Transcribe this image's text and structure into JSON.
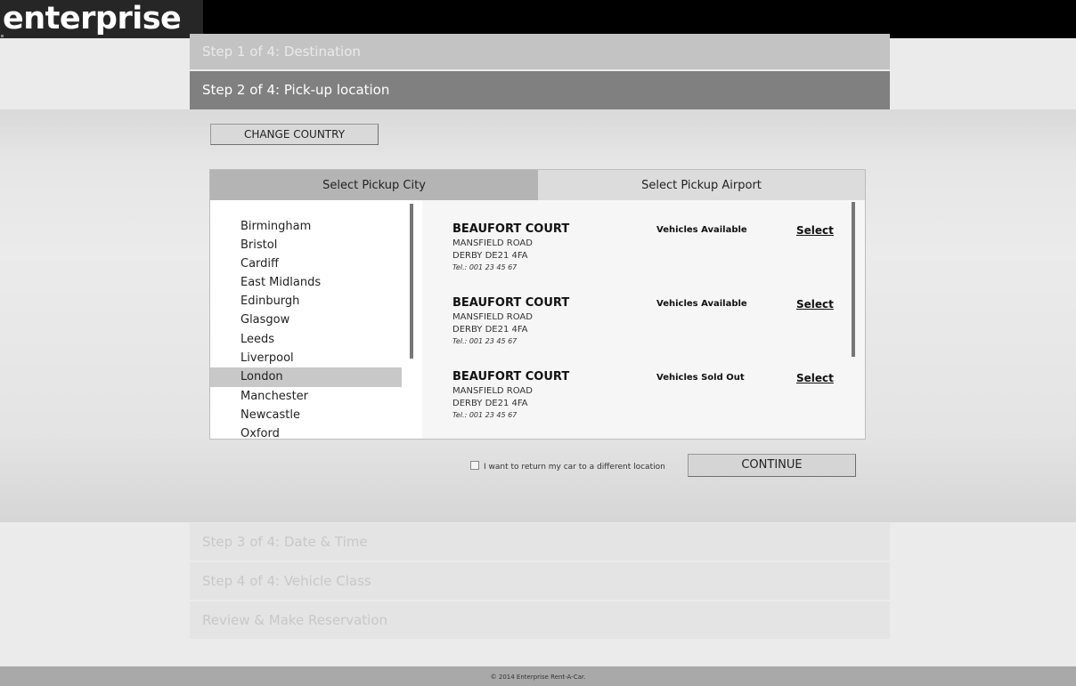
{
  "header": {
    "logo_text": "enterprise"
  },
  "steps": [
    "Step 1 of 4: Destination",
    "Step 2 of 4: Pick-up location",
    "Step 3 of 4: Date & Time",
    "Step 4 of 4: Vehicle Class",
    "Review & Make Reservation"
  ],
  "change_country_label": "CHANGE COUNTRY",
  "tabs": {
    "city": "Select Pickup City",
    "airport": "Select Pickup Airport"
  },
  "cities": [
    "Birmingham",
    "Bristol",
    "Cardiff",
    "East Midlands",
    "Edinburgh",
    "Glasgow",
    "Leeds",
    "Liverpool",
    "London",
    "Manchester",
    "Newcastle",
    "Oxford"
  ],
  "selected_city": "London",
  "locations": [
    {
      "name": "BEAUFORT COURT",
      "line1": "MANSFIELD ROAD",
      "line2": "DERBY DE21 4FA",
      "tel": "Tel.: 001 23 45 67",
      "status": "Vehicles Available",
      "select": "Select"
    },
    {
      "name": "BEAUFORT COURT",
      "line1": "MANSFIELD ROAD",
      "line2": "DERBY DE21 4FA",
      "tel": "Tel.: 001 23 45 67",
      "status": "Vehicles Available",
      "select": "Select"
    },
    {
      "name": "BEAUFORT COURT",
      "line1": "MANSFIELD ROAD",
      "line2": "DERBY DE21 4FA",
      "tel": "Tel.: 001 23 45 67",
      "status": "Vehicles Sold Out",
      "select": "Select"
    }
  ],
  "return_checkbox_label": "I want to return my car to a different location",
  "return_checked": false,
  "continue_label": "CONTINUE",
  "footer_text": "© 2014 Enterprise Rent-A-Car."
}
